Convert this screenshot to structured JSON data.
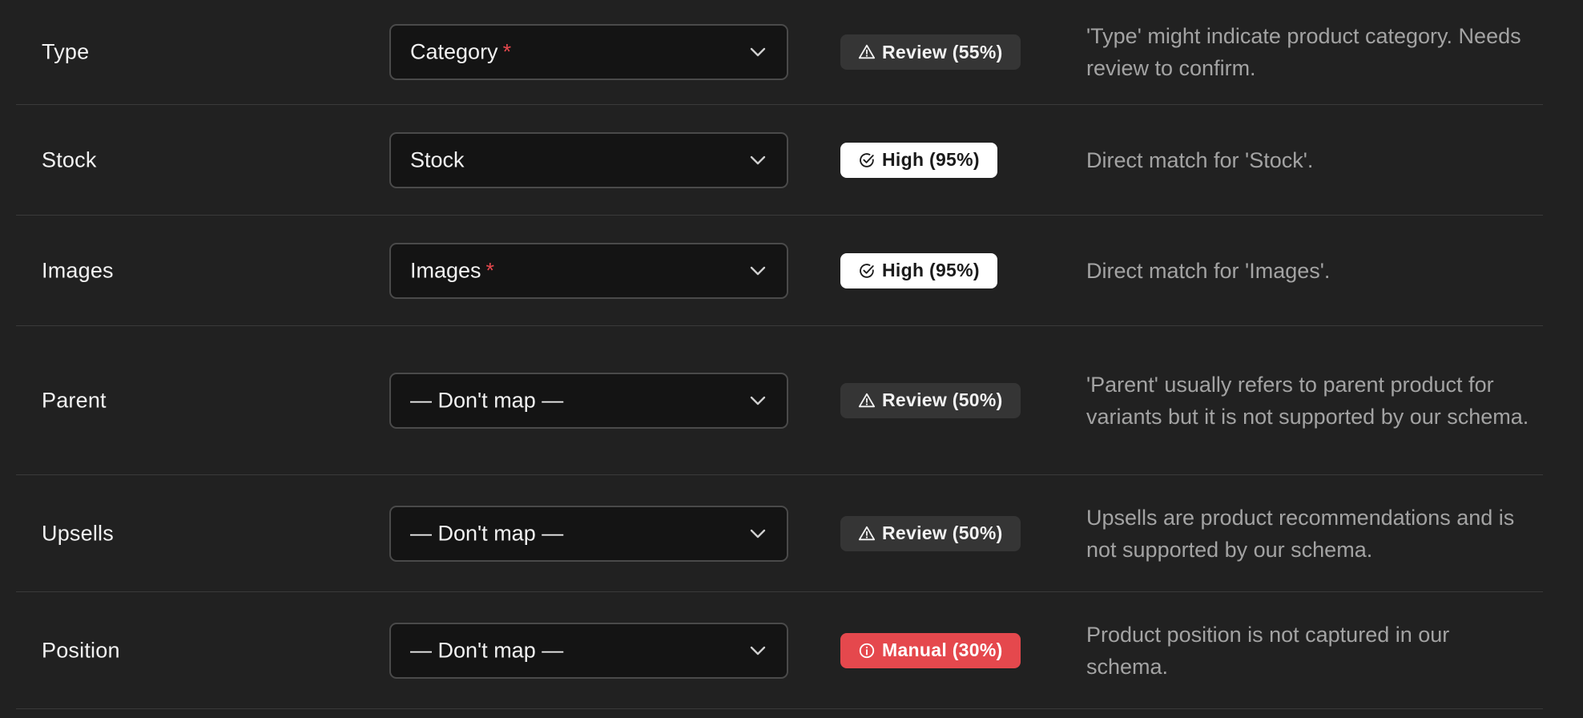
{
  "rows": [
    {
      "source": "Type",
      "target": "Category",
      "required": "*",
      "confidence": "Review (55%)",
      "confidence_level": "review",
      "icon": "warning-icon",
      "note": "'Type' might indicate product category. Needs review to confirm."
    },
    {
      "source": "Stock",
      "target": "Stock",
      "required": "",
      "confidence": "High (95%)",
      "confidence_level": "high",
      "icon": "check-circle-icon",
      "note": "Direct match for 'Stock'."
    },
    {
      "source": "Images",
      "target": "Images",
      "required": "*",
      "confidence": "High (95%)",
      "confidence_level": "high",
      "icon": "check-circle-icon",
      "note": "Direct match for 'Images'."
    },
    {
      "source": "Parent",
      "target": "— Don't map —",
      "required": "",
      "confidence": "Review (50%)",
      "confidence_level": "review",
      "icon": "warning-icon",
      "note": "'Parent' usually refers to parent product for variants but it is not supported by our schema."
    },
    {
      "source": "Upsells",
      "target": "— Don't map —",
      "required": "",
      "confidence": "Review (50%)",
      "confidence_level": "review",
      "icon": "warning-icon",
      "note": "Upsells are product recommendations and is not supported by our schema."
    },
    {
      "source": "Position",
      "target": "— Don't map —",
      "required": "",
      "confidence": "Manual (30%)",
      "confidence_level": "manual",
      "icon": "info-circle-icon",
      "note": "Product position is not captured in our schema."
    }
  ],
  "colors": {
    "background": "#212121",
    "select_background": "#141414",
    "required": "#e5484d",
    "review_badge": "#353535",
    "high_badge": "#ffffff",
    "manual_badge": "#e5484d"
  }
}
